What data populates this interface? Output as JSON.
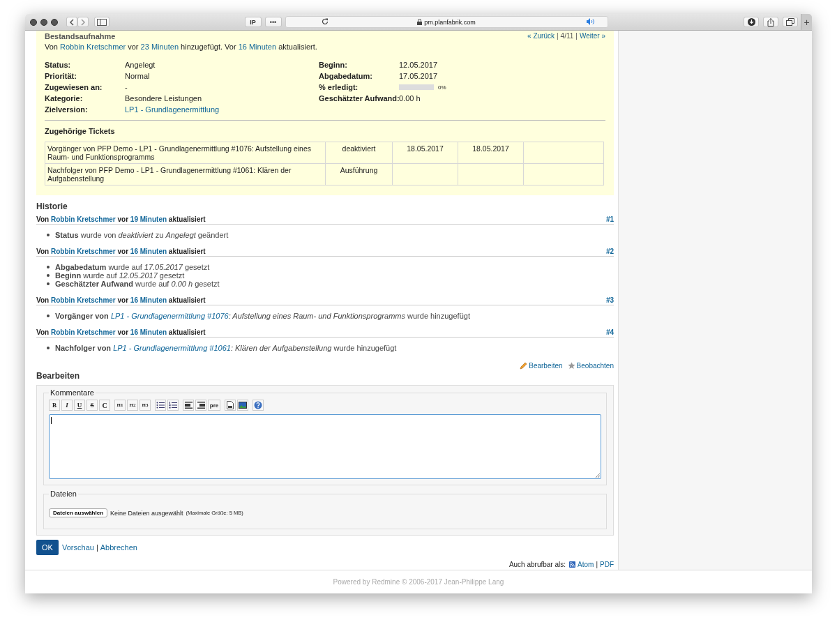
{
  "browser": {
    "buttons": [
      "IP",
      "•••"
    ],
    "url": "pm.planfabrik.com",
    "new_tab": "+"
  },
  "issue": {
    "title": "Bestandsaufnahme",
    "nav": {
      "prev": "« Zurück",
      "counter": "4/11",
      "next": "Weiter »",
      "separator": "|"
    },
    "meta": [
      {
        "kind": "text",
        "text": "Von "
      },
      {
        "kind": "link",
        "text": "Robbin Kretschmer"
      },
      {
        "kind": "text",
        "text": " vor "
      },
      {
        "kind": "link",
        "text": "23 Minuten"
      },
      {
        "kind": "text",
        "text": " hinzugefügt. Vor "
      },
      {
        "kind": "link",
        "text": "16 Minuten"
      },
      {
        "kind": "text",
        "text": " aktualisiert."
      }
    ],
    "attributes_left": [
      {
        "label": "Status:",
        "kind": "text",
        "value": "Angelegt"
      },
      {
        "label": "Priorität:",
        "kind": "text",
        "value": "Normal"
      },
      {
        "label": "Zugewiesen an:",
        "kind": "text",
        "value": "-"
      },
      {
        "label": "Kategorie:",
        "kind": "text",
        "value": "Besondere Leistungen"
      },
      {
        "label": "Zielversion:",
        "kind": "link",
        "value": "LP1 - Grundlagenermittlung"
      }
    ],
    "attributes_right": [
      {
        "label": "Beginn:",
        "kind": "text",
        "value": "12.05.2017"
      },
      {
        "label": "Abgabedatum:",
        "kind": "text",
        "value": "17.05.2017"
      },
      {
        "label": "% erledigt:",
        "kind": "progress",
        "level": 0,
        "value": "0%"
      },
      {
        "label": "Geschätzter Aufwand:",
        "kind": "text",
        "value": "0.00 h"
      }
    ],
    "relations": {
      "title": "Zugehörige Tickets",
      "rows": [
        {
          "cells": [
            "Vorgänger von PFP Demo - LP1 - Grundlagenermittlung #1076: Aufstellung eines Raum- und Funktionsprogramms",
            "deaktiviert",
            "18.05.2017",
            "18.05.2017"
          ]
        },
        {
          "cells": [
            "Nachfolger von PFP Demo - LP1 - Grundlagenermittlung #1061: Klären der Aufgabenstellung",
            "Ausführung"
          ]
        }
      ]
    }
  },
  "history": {
    "title": "Historie",
    "journals": [
      {
        "header": [
          {
            "kind": "text",
            "text": "Von "
          },
          {
            "kind": "link",
            "text": "Robbin Kretschmer"
          },
          {
            "kind": "text",
            "text": " vor "
          },
          {
            "kind": "link",
            "text": "19 Minuten"
          },
          {
            "kind": "text",
            "text": " aktualisiert"
          }
        ],
        "number": "#1",
        "details": [
          {
            "text": "**Status** wurde von *deaktiviert* zu *Angelegt* geändert"
          }
        ]
      },
      {
        "header": [
          {
            "kind": "text",
            "text": "Von "
          },
          {
            "kind": "link",
            "text": "Robbin Kretschmer"
          },
          {
            "kind": "text",
            "text": " vor "
          },
          {
            "kind": "link",
            "text": "16 Minuten"
          },
          {
            "kind": "text",
            "text": " aktualisiert"
          }
        ],
        "number": "#2",
        "details": [
          {
            "text": "**Abgabedatum** wurde auf *17.05.2017* gesetzt"
          },
          {
            "text": "**Beginn** wurde auf *12.05.2017* gesetzt"
          },
          {
            "text": "**Geschätzter Aufwand** wurde auf *0.00 h* gesetzt"
          }
        ]
      },
      {
        "header": [
          {
            "kind": "text",
            "text": "Von "
          },
          {
            "kind": "link",
            "text": "Robbin Kretschmer"
          },
          {
            "kind": "text",
            "text": " vor "
          },
          {
            "kind": "link",
            "text": "16 Minuten"
          },
          {
            "kind": "text",
            "text": " aktualisiert"
          }
        ],
        "number": "#3",
        "details": [
          {
            "text": "**Vorgänger von** ",
            "link": "LP1 - Grundlagenermittlung #1076",
            "after": "*: Aufstellung eines Raum- und Funktionsprogramms* wurde hinzugefügt"
          }
        ]
      },
      {
        "header": [
          {
            "kind": "text",
            "text": "Von "
          },
          {
            "kind": "link",
            "text": "Robbin Kretschmer"
          },
          {
            "kind": "text",
            "text": " vor "
          },
          {
            "kind": "link",
            "text": "16 Minuten"
          },
          {
            "kind": "text",
            "text": " aktualisiert"
          }
        ],
        "number": "#4",
        "details": [
          {
            "text": "**Nachfolger von** ",
            "link": "LP1 - Grundlagenermittlung #1061",
            "after": "*: Klären der Aufgabenstellung* wurde hinzugefügt"
          }
        ]
      }
    ]
  },
  "actions": [
    {
      "kind": "edit",
      "label": "Bearbeiten"
    },
    {
      "kind": "watch",
      "label": "Beobachten"
    }
  ],
  "edit": {
    "title": "Bearbeiten",
    "comments_legend": "Kommentare",
    "toolbar": [
      [
        {
          "kind": "bold",
          "label": "B"
        },
        {
          "kind": "italic",
          "label": "I"
        },
        {
          "kind": "underline",
          "label": "U"
        },
        {
          "kind": "strike",
          "label": "S"
        },
        {
          "kind": "code",
          "label": "C"
        }
      ],
      [
        {
          "kind": "heading",
          "label": "H1"
        },
        {
          "kind": "heading",
          "label": "H2"
        },
        {
          "kind": "heading",
          "label": "H3"
        }
      ],
      [
        {
          "kind": "ul"
        },
        {
          "kind": "ol"
        }
      ],
      [
        {
          "kind": "indent"
        },
        {
          "kind": "outdent"
        },
        {
          "kind": "pre",
          "label": "pre"
        }
      ],
      [
        {
          "kind": "page"
        },
        {
          "kind": "image"
        }
      ],
      [
        {
          "kind": "help"
        }
      ]
    ],
    "files_legend": "Dateien",
    "file_button": "Dateien auswählen",
    "file_status": "Keine Dateien ausgewählt",
    "max_size": "(Maximale Größe: 5 MB)",
    "submit": "OK",
    "preview": "Vorschau",
    "separator": "|",
    "cancel": "Abbrechen"
  },
  "export": {
    "label": "Auch abrufbar als:",
    "separator": "|",
    "formats": [
      {
        "kind": "atom",
        "label": "Atom"
      },
      {
        "kind": "pdf",
        "label": "PDF"
      }
    ]
  },
  "footer": "Powered by Redmine © 2006-2017 Jean-Philippe Lang"
}
